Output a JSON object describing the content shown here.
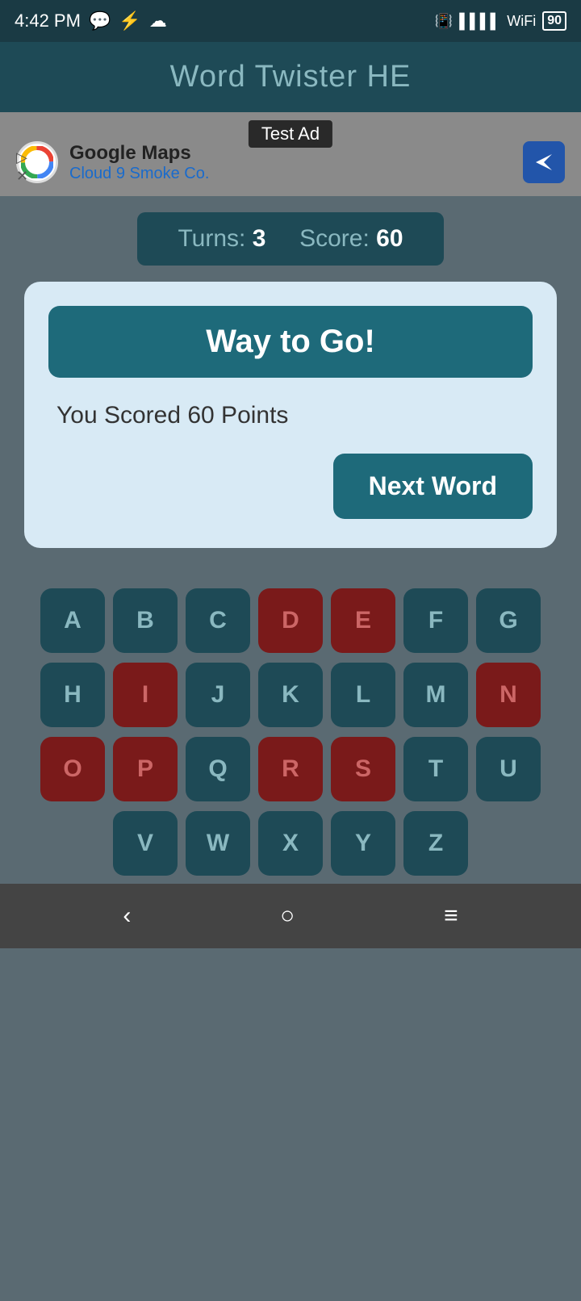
{
  "statusBar": {
    "time": "4:42 PM",
    "battery": "90"
  },
  "header": {
    "title": "Word Twister HE"
  },
  "ad": {
    "testLabel": "Test Ad",
    "company": "Google Maps",
    "subtitle": "Cloud 9 Smoke Co."
  },
  "scoreBar": {
    "turnsLabel": "Turns:",
    "turnsValue": "3",
    "scoreLabel": "Score:",
    "scoreValue": "60"
  },
  "dialog": {
    "titleText": "Way to Go!",
    "bodyText": "You Scored 60 Points",
    "nextWordBtn": "Next Word"
  },
  "keyboard": {
    "rows": [
      [
        "A",
        "B",
        "C",
        "D",
        "E",
        "F",
        "G"
      ],
      [
        "H",
        "I",
        "J",
        "K",
        "L",
        "M",
        "N"
      ],
      [
        "O",
        "P",
        "Q",
        "R",
        "S",
        "T",
        "U"
      ],
      [
        "V",
        "W",
        "X",
        "Y",
        "Z"
      ]
    ],
    "usedKeys": [
      "D",
      "E",
      "I",
      "N",
      "O",
      "P",
      "R",
      "S"
    ]
  },
  "navBar": {
    "backIcon": "‹",
    "homeIcon": "○",
    "menuIcon": "≡"
  }
}
